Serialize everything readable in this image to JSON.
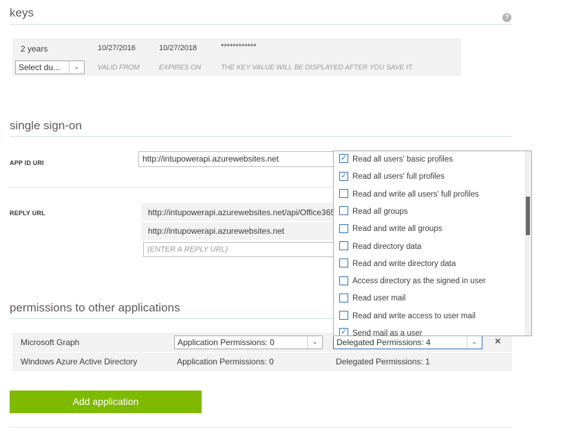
{
  "keys": {
    "title": "keys",
    "help_icon": "?",
    "row": {
      "duration": "2 years",
      "valid_from": "10/27/2016",
      "expires_on": "10/27/2018",
      "value": "************"
    },
    "new_row": {
      "select_value": "Select du...",
      "valid_from_hint": "VALID FROM",
      "expires_hint": "EXPIRES ON",
      "value_hint": "THE KEY VALUE WILL BE DISPLAYED AFTER YOU SAVE IT."
    }
  },
  "sso": {
    "title": "single sign-on",
    "app_id_label": "APP ID URI",
    "app_id_value": "http://intupowerapi.azurewebsites.net",
    "reply_label": "REPLY URL",
    "reply_urls": [
      "http://intupowerapi.azurewebsites.net/api/Office365",
      "http://intupowerapi.azurewebsites.net"
    ],
    "reply_placeholder": "(ENTER A REPLY URL)"
  },
  "perms": {
    "title": "permissions to other applications",
    "rows": [
      {
        "app": "Microsoft Graph",
        "app_perms": "Application Permissions: 0",
        "delegated": "Delegated Permissions: 4",
        "remove": "×"
      },
      {
        "app": "Windows Azure Active Directory",
        "app_perms": "Application Permissions: 0",
        "delegated": "Delegated Permissions: 1"
      }
    ],
    "add_button": "Add application"
  },
  "dropdown": {
    "items": [
      {
        "label": "Read all users' basic profiles",
        "checked": true
      },
      {
        "label": "Read all users' full profiles",
        "checked": true
      },
      {
        "label": "Read and write all users' full profiles",
        "checked": false
      },
      {
        "label": "Read all groups",
        "checked": false
      },
      {
        "label": "Read and write all groups",
        "checked": false
      },
      {
        "label": "Read directory data",
        "checked": false
      },
      {
        "label": "Read and write directory data",
        "checked": false
      },
      {
        "label": "Access directory as the signed in user",
        "checked": false
      },
      {
        "label": "Read user mail",
        "checked": false
      },
      {
        "label": "Read and write access to user mail",
        "checked": false
      },
      {
        "label": "Send mail as a user",
        "checked": true
      }
    ]
  },
  "icons": {
    "chevron": "chevron-down-icon",
    "check": "checkmark-icon",
    "help": "help-icon",
    "close": "close-icon"
  },
  "colors": {
    "accent_green": "#7fba00",
    "rule_teal": "#c9e6e4",
    "checkbox_blue": "#2a70b4"
  }
}
